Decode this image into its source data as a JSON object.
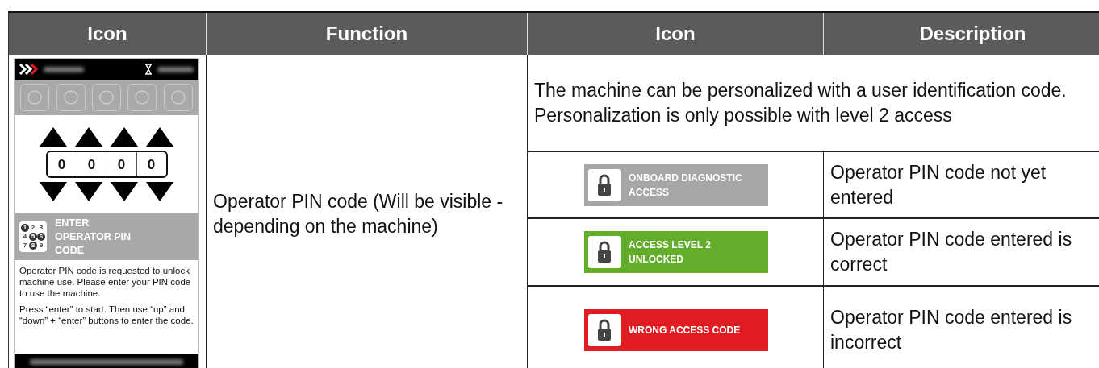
{
  "table": {
    "columns": [
      "Icon",
      "Function",
      "Icon",
      "Description"
    ],
    "screen": {
      "digits": [
        "0",
        "0",
        "0",
        "0"
      ],
      "keypad": [
        {
          "digit": "1",
          "marked": true
        },
        {
          "digit": "2",
          "marked": false
        },
        {
          "digit": "3",
          "marked": false
        },
        {
          "digit": "4",
          "marked": false
        },
        {
          "digit": "5",
          "marked": true
        },
        {
          "digit": "6",
          "marked": true
        },
        {
          "digit": "7",
          "marked": false
        },
        {
          "digit": "8",
          "marked": true
        },
        {
          "digit": "9",
          "marked": false
        }
      ],
      "banner": "ENTER OPERATOR PIN CODE",
      "paragraphs": [
        "Operator PIN code is requested to unlock machine use. Please enter your PIN code to use the machine.",
        "Press “enter” to start. Then use “up” and “down” + “enter” buttons to enter the code."
      ]
    },
    "function": "Operator PIN code  (Will be visible - depending on the machine)",
    "intro": "The machine can be personalized with a user identification code. Personalization is only possible with level 2 access",
    "rows": [
      {
        "badge": "ONBOARD DIAGNOSTIC ACCESS",
        "color": "#a6a6a6",
        "description": "Operator PIN code not yet entered"
      },
      {
        "badge": "ACCESS LEVEL 2 UNLOCKED",
        "color": "#62ad2a",
        "description": "Operator PIN code entered is correct"
      },
      {
        "badge": "WRONG ACCESS CODE",
        "color": "#e11b22",
        "description": "Operator PIN code entered is incorrect"
      }
    ]
  }
}
